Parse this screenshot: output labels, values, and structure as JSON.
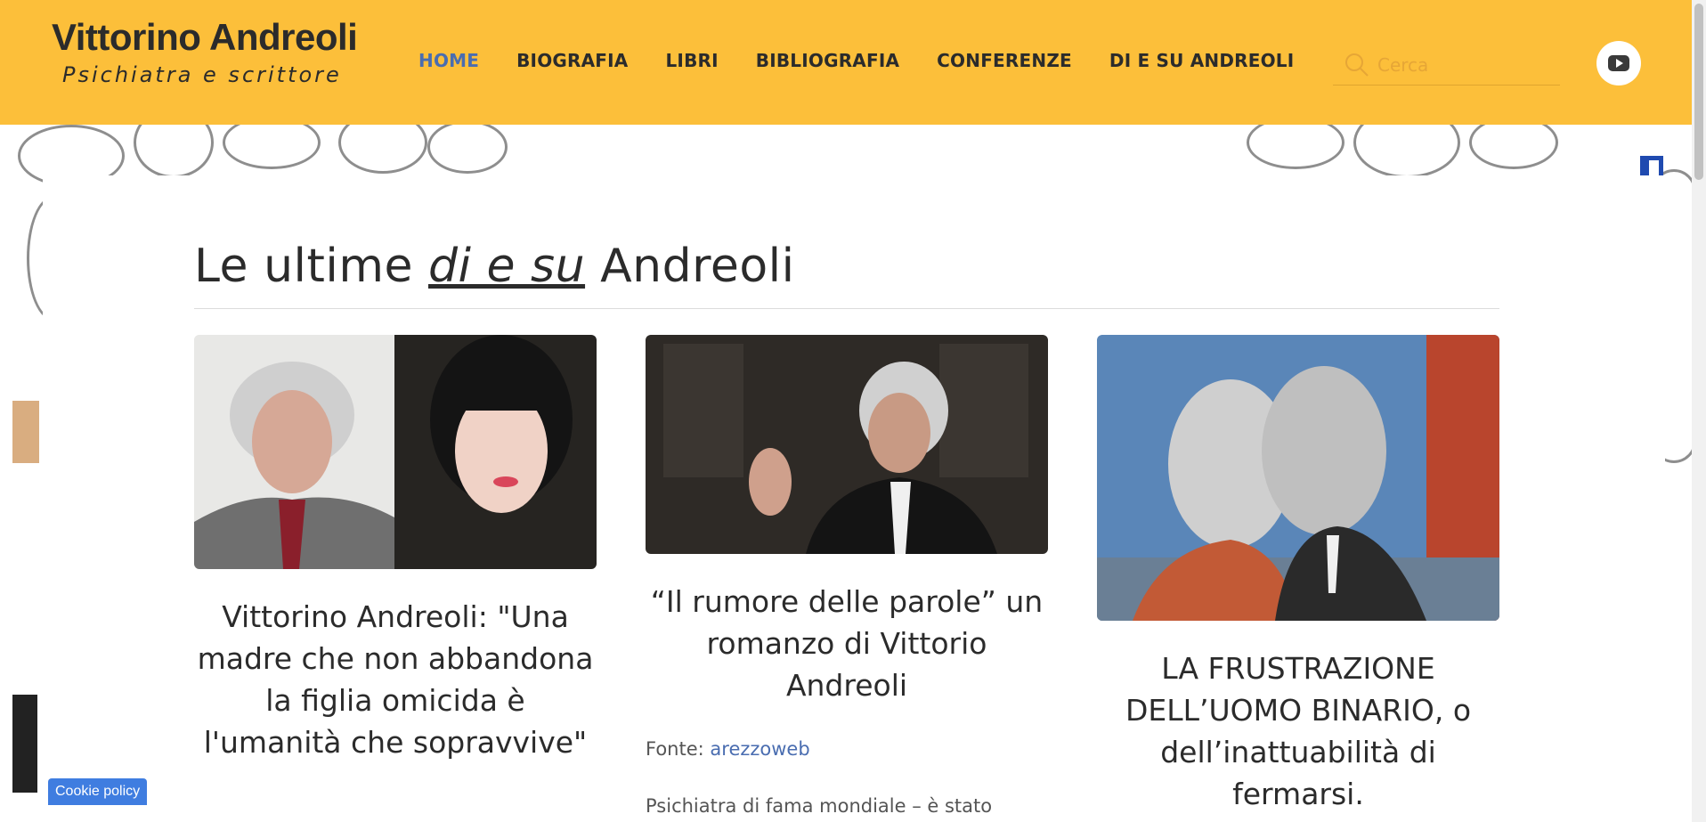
{
  "header": {
    "brand_title": "Vittorino Andreoli",
    "brand_subtitle": "Psichiatra e scrittore",
    "nav": [
      {
        "label": "HOME",
        "active": true
      },
      {
        "label": "BIOGRAFIA",
        "active": false
      },
      {
        "label": "LIBRI",
        "active": false
      },
      {
        "label": "BIBLIOGRAFIA",
        "active": false
      },
      {
        "label": "CONFERENZE",
        "active": false
      },
      {
        "label": "DI E SU ANDREOLI",
        "active": false
      }
    ],
    "search": {
      "placeholder": "Cerca",
      "value": ""
    },
    "youtube_icon": "youtube-icon"
  },
  "section": {
    "title_prefix": "Le ultime ",
    "title_em": "di e su",
    "title_suffix": " Andreoli"
  },
  "cards": [
    {
      "title": "Vittorino Andreoli: \"Una madre che non abbandona la figlia omicida è l'umanità che sopravvive\""
    },
    {
      "title": "“Il rumore delle parole” un romanzo di Vittorio Andreoli",
      "source_label": "Fonte: ",
      "source_link": "arezzoweb",
      "excerpt": "Psichiatra di fama mondiale – è stato"
    },
    {
      "title": "LA FRUSTRAZIONE DELL’UOMO BINARIO, o dell’inattuabilità di fermarsi."
    }
  ],
  "cookie_label": "Cookie policy",
  "colors": {
    "header_bg": "#fcbf3a",
    "accent": "#4a6db0",
    "cookie_bg": "#3f7de0"
  }
}
